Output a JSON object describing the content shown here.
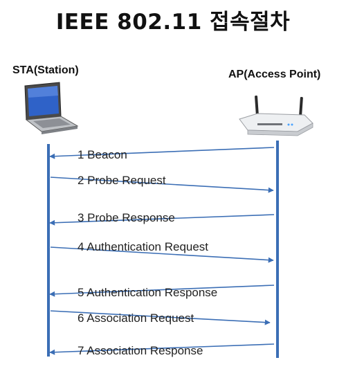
{
  "title": "IEEE 802.11 접속절차",
  "sta": {
    "label": "STA(Station)"
  },
  "ap": {
    "label": "AP(Access Point)"
  },
  "colors": {
    "line": "#3b6eb5",
    "text": "#222222"
  },
  "messages": [
    {
      "label": "1 Beacon",
      "direction": "ap-to-sta"
    },
    {
      "label": "2 Probe Request",
      "direction": "sta-to-ap"
    },
    {
      "label": "3 Probe Response",
      "direction": "ap-to-sta"
    },
    {
      "label": "4 Authentication Request",
      "direction": "sta-to-ap"
    },
    {
      "label": "5 Authentication Response",
      "direction": "ap-to-sta"
    },
    {
      "label": "6 Association Request",
      "direction": "sta-to-ap"
    },
    {
      "label": "7 Association Response",
      "direction": "ap-to-sta"
    }
  ]
}
